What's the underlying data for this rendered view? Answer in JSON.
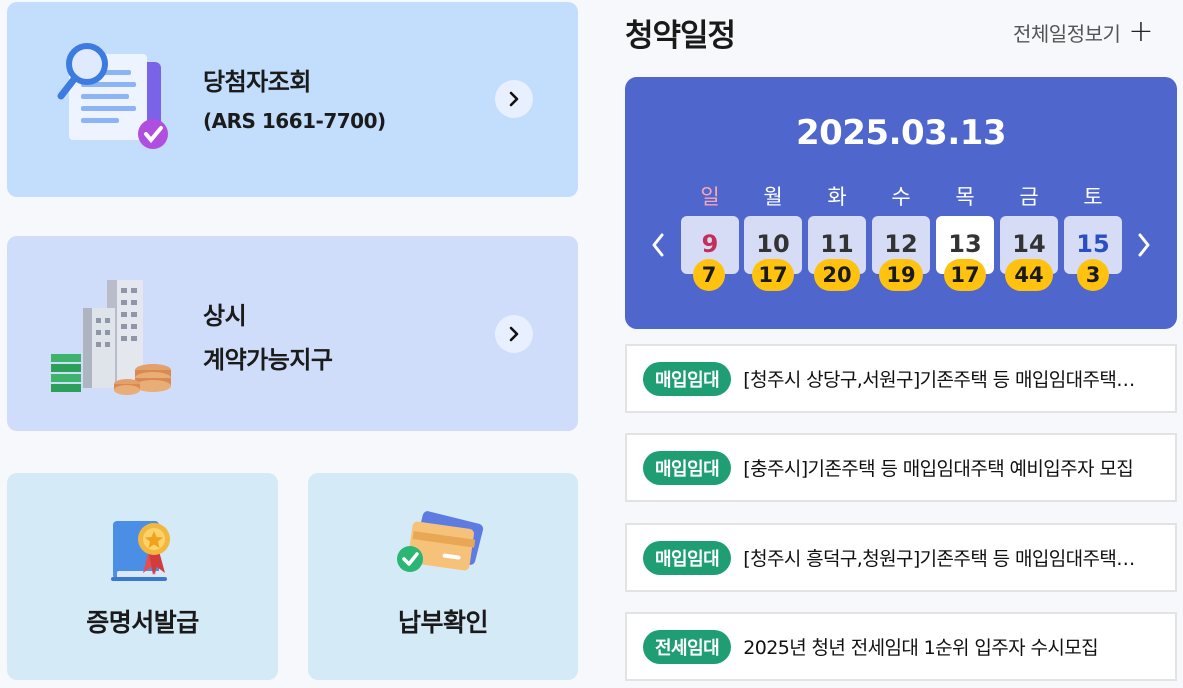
{
  "cards": {
    "winner": {
      "title": "당첨자조회",
      "subtitle": "(ARS 1661-7700)"
    },
    "contract": {
      "title_line1": "상시",
      "title_line2": "계약가능지구"
    },
    "certificate": {
      "title": "증명서발급"
    },
    "payment": {
      "title": "납부확인"
    }
  },
  "schedule": {
    "title": "청약일정",
    "view_all": "전체일정보기",
    "date": "2025.03.13",
    "days": [
      {
        "name": "일",
        "num": "9",
        "count": "7"
      },
      {
        "name": "월",
        "num": "10",
        "count": "17"
      },
      {
        "name": "화",
        "num": "11",
        "count": "20"
      },
      {
        "name": "수",
        "num": "12",
        "count": "19"
      },
      {
        "name": "목",
        "num": "13",
        "count": "17"
      },
      {
        "name": "금",
        "num": "14",
        "count": "44"
      },
      {
        "name": "토",
        "num": "15",
        "count": "3"
      }
    ],
    "selected_day": "13"
  },
  "notices": [
    {
      "tag": "매입임대",
      "text": "[청주시 상당구,서원구]기존주택 등 매입임대주택 예비입주자 모집"
    },
    {
      "tag": "매입임대",
      "text": "[충주시]기존주택 등 매입임대주택 예비입주자 모집"
    },
    {
      "tag": "매입임대",
      "text": "[청주시 흥덕구,청원구]기존주택 등 매입임대주택 예비입주자 모집"
    },
    {
      "tag": "전세임대",
      "text": "2025년 청년 전세임대 1순위 입주자 수시모집"
    }
  ],
  "colors": {
    "calendar_bg": "#4f67cc",
    "badge": "#ffc20e",
    "tag": "#1f9e74",
    "sunday": "#c0305a",
    "saturday": "#2a4fc4"
  },
  "icons": {
    "winner": "document-search-icon",
    "contract": "buildings-coins-icon",
    "certificate": "certificate-medal-icon",
    "payment": "credit-card-check-icon"
  }
}
